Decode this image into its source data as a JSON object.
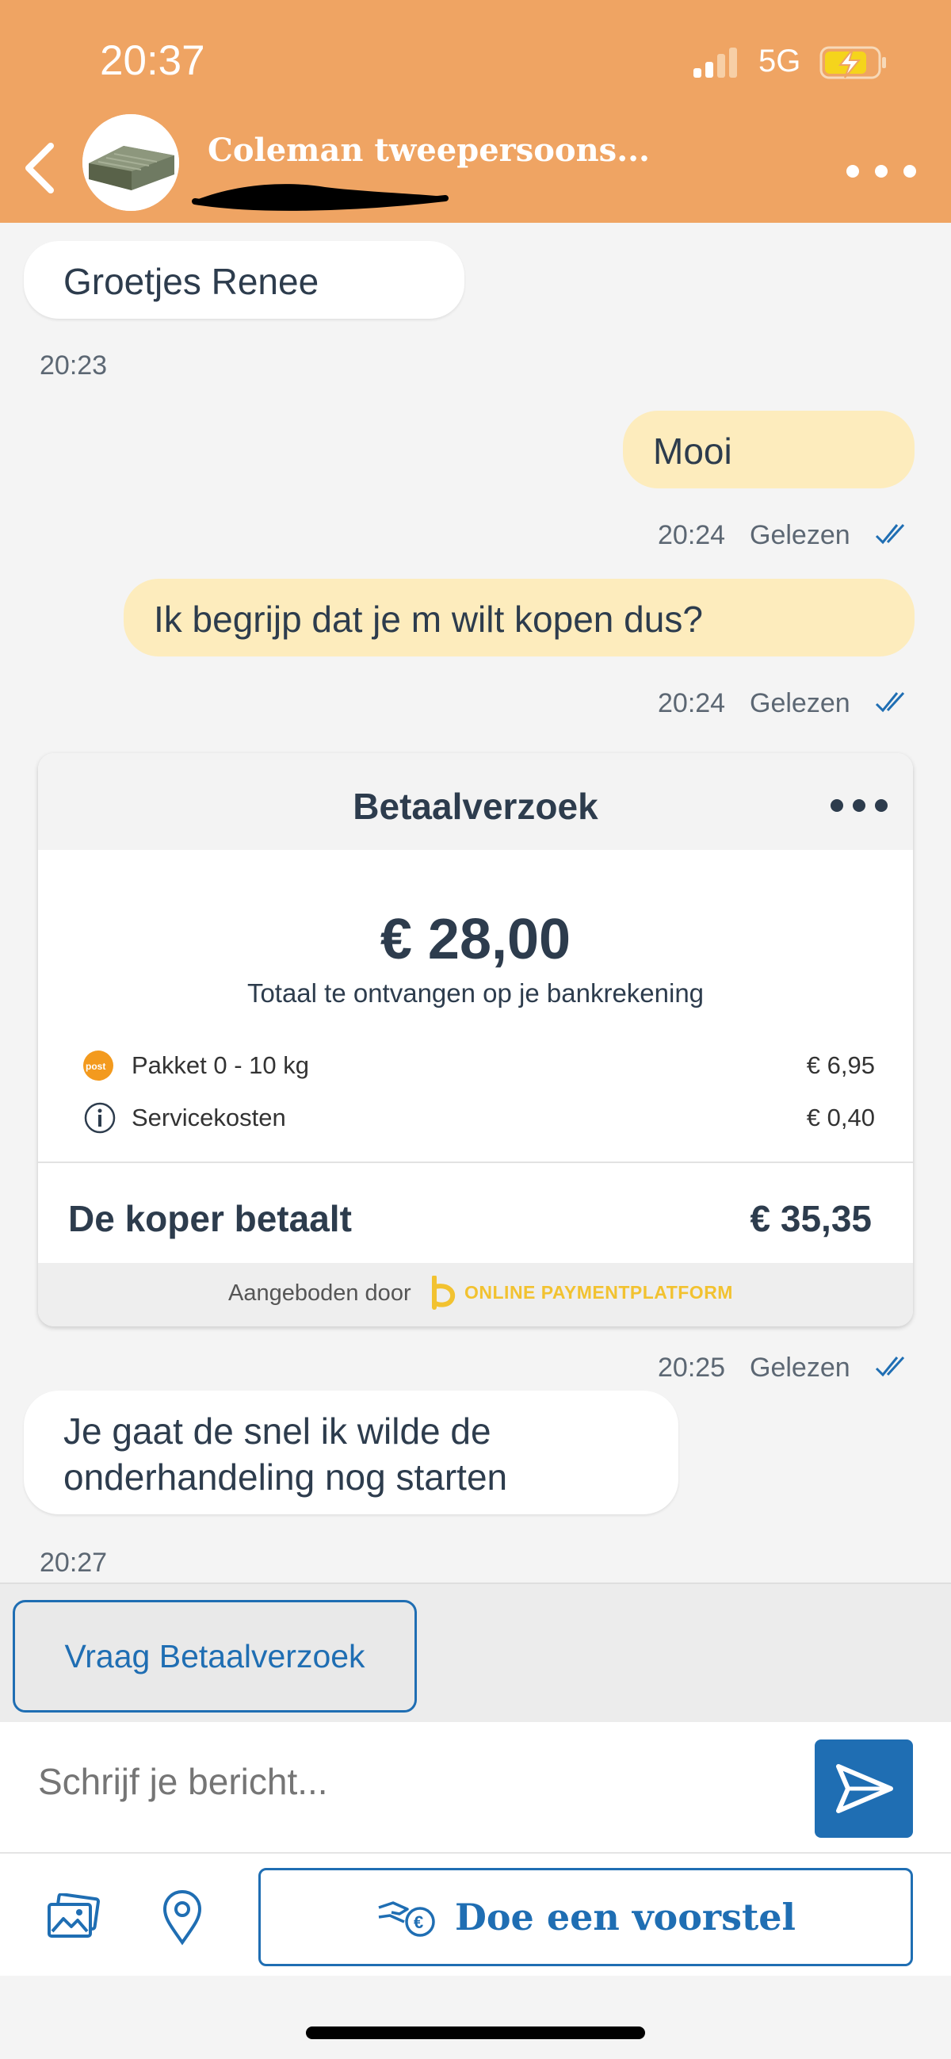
{
  "status_bar": {
    "time": "20:37",
    "network": "5G"
  },
  "header": {
    "title": "Coleman tweepersoons...",
    "colors": {
      "background": "#efa463"
    }
  },
  "messages": [
    {
      "direction": "in",
      "text": "Groetjes Renee",
      "time": "20:23"
    },
    {
      "direction": "out",
      "text": "Mooi",
      "time": "20:24",
      "status": "Gelezen"
    },
    {
      "direction": "out",
      "text": "Ik begrijp dat je m wilt kopen dus?",
      "time": "20:24",
      "status": "Gelezen"
    },
    {
      "direction": "out",
      "type": "payment_request",
      "time": "20:25",
      "status": "Gelezen"
    },
    {
      "direction": "in",
      "text_lines": [
        "Je gaat de snel ik wilde de",
        "onderhandeling nog starten"
      ],
      "time": "20:27"
    }
  ],
  "payment_request": {
    "title": "Betaalverzoek",
    "amount": "€ 28,00",
    "amount_caption": "Totaal te ontvangen op je bankrekening",
    "rows": [
      {
        "icon": "postnl-icon",
        "label": "Pakket 0 - 10 kg",
        "value": "€ 6,95"
      },
      {
        "icon": "info-icon",
        "label": "Servicekosten",
        "value": "€ 0,40"
      }
    ],
    "buyer_label": "De koper betaalt",
    "buyer_amount": "€ 35,35",
    "offered_by": "Aangeboden door",
    "platform": "ONLINE PAYMENTPLATFORM"
  },
  "quick_actions": {
    "request_payment": "Vraag Betaalverzoek"
  },
  "composer": {
    "placeholder": "Schrijf je bericht..."
  },
  "toolbar": {
    "offer_label": "Doe een voorstel"
  },
  "colors": {
    "accent_blue": "#1f6eb3",
    "outgoing_bubble": "#fdecbd",
    "incoming_bubble": "#ffffff"
  }
}
